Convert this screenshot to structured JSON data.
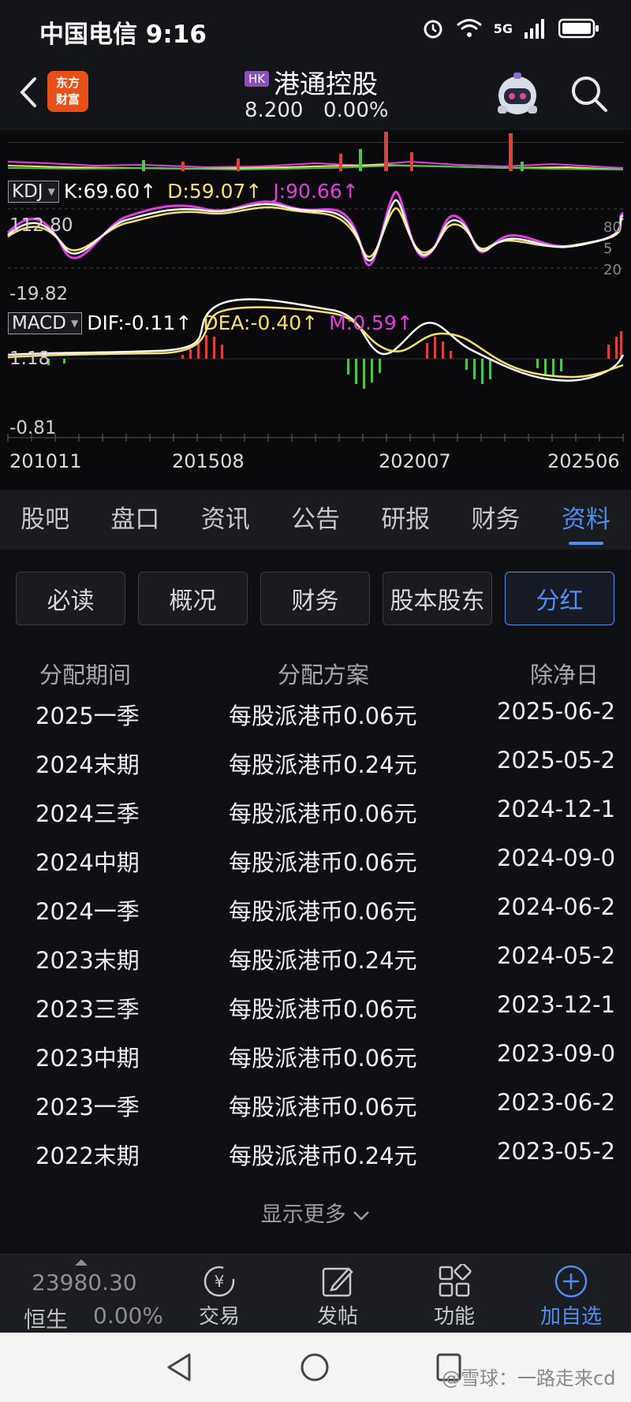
{
  "status_bar": {
    "carrier_time": "中国电信 9:16",
    "network": "5G"
  },
  "header": {
    "logo_text_line1": "东方",
    "logo_text_line2": "财富",
    "market_badge": "HK",
    "stock_name": "港通控股",
    "price": "8.200",
    "change_pct": "0.00%"
  },
  "chart": {
    "kdj": {
      "label": "KDJ",
      "k": "K:69.60↑",
      "d": "D:59.07↑",
      "j": "J:90.66↑",
      "y_max": "112.80",
      "y_min": "-19.82",
      "right_top": "80",
      "right_mid": "5",
      "right_bot": "20"
    },
    "macd": {
      "label": "MACD",
      "dif": "DIF:-0.11↑",
      "dea": "DEA:-0.40↑",
      "m": "M:0.59↑",
      "y_max": "1.18",
      "y_min": "-0.81"
    },
    "dates": [
      "201011",
      "201508",
      "202007",
      "202506"
    ],
    "colors": {
      "k": "#ffffff",
      "d": "#f5e26b",
      "j": "#e040e0",
      "up": "#e0403a",
      "down": "#4fc34f"
    }
  },
  "tabs": [
    "股吧",
    "盘口",
    "资讯",
    "公告",
    "研报",
    "财务",
    "资料"
  ],
  "active_tab": 6,
  "subtabs": [
    "必读",
    "概况",
    "财务",
    "股本股东",
    "分红"
  ],
  "active_subtab": 4,
  "dividend_table": {
    "headers": [
      "分配期间",
      "分配方案",
      "除净日"
    ],
    "rows": [
      [
        "2025一季",
        "每股派港币0.06元",
        "2025-06-2"
      ],
      [
        "2024末期",
        "每股派港币0.24元",
        "2025-05-2"
      ],
      [
        "2024三季",
        "每股派港币0.06元",
        "2024-12-1"
      ],
      [
        "2024中期",
        "每股派港币0.06元",
        "2024-09-0"
      ],
      [
        "2024一季",
        "每股派港币0.06元",
        "2024-06-2"
      ],
      [
        "2023末期",
        "每股派港币0.24元",
        "2024-05-2"
      ],
      [
        "2023三季",
        "每股派港币0.06元",
        "2023-12-1"
      ],
      [
        "2023中期",
        "每股派港币0.06元",
        "2023-09-0"
      ],
      [
        "2023一季",
        "每股派港币0.06元",
        "2023-06-2"
      ],
      [
        "2022末期",
        "每股派港币0.24元",
        "2023-05-2"
      ]
    ],
    "show_more": "显示更多"
  },
  "bottom_nav": {
    "index_value": "23980.30",
    "index_name": "恒生",
    "index_pct": "0.00%",
    "items": [
      "交易",
      "发帖",
      "功能",
      "加自选"
    ]
  },
  "watermark": "@雪球：一路走来cd"
}
